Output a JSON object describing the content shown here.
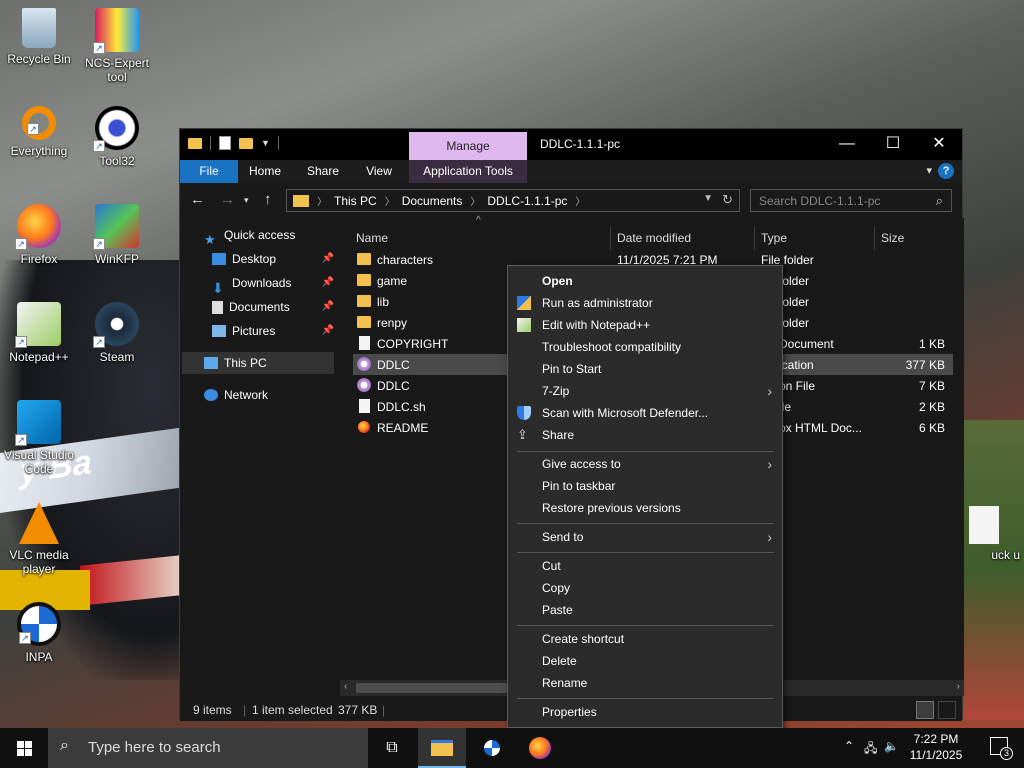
{
  "desktop": {
    "icons": [
      {
        "label": "Recycle Bin"
      },
      {
        "label": "NCS-Expert tool"
      },
      {
        "label": "Everything"
      },
      {
        "label": "Tool32"
      },
      {
        "label": "Firefox"
      },
      {
        "label": "WinKFP"
      },
      {
        "label": "Notepad++"
      },
      {
        "label": "Steam"
      },
      {
        "label": "Visual Studio Code"
      },
      {
        "label": "VLC media player"
      },
      {
        "label": "INPA"
      },
      {
        "label": "uck u"
      }
    ],
    "wallpaper_car_text": "y Ba"
  },
  "window": {
    "title": "DDLC-1.1.1-pc",
    "manage_tab": "Manage",
    "ribbon_tabs": [
      "File",
      "Home",
      "Share",
      "View",
      "Application Tools"
    ],
    "controls": {
      "minimize": "—",
      "maximize": "☐",
      "close": "✕"
    },
    "help": "?"
  },
  "address": {
    "crumbs": [
      "This PC",
      "Documents",
      "DDLC-1.1.1-pc"
    ],
    "search_placeholder": "Search DDLC-1.1.1-pc"
  },
  "nav_pane": {
    "items": [
      "Quick access",
      "Desktop",
      "Downloads",
      "Documents",
      "Pictures",
      "This PC",
      "Network"
    ]
  },
  "columns": {
    "name": "Name",
    "date": "Date modified",
    "type": "Type",
    "size": "Size"
  },
  "files": [
    {
      "name": "characters",
      "date": "11/1/2025 7:21 PM",
      "type": "File folder",
      "size": ""
    },
    {
      "name": "game",
      "date": "",
      "type": "folder",
      "size": ""
    },
    {
      "name": "lib",
      "date": "",
      "type": "folder",
      "size": ""
    },
    {
      "name": "renpy",
      "date": "",
      "type": "folder",
      "size": ""
    },
    {
      "name": "COPYRIGHT",
      "date": "",
      "type": "Document",
      "size": "1 KB"
    },
    {
      "name": "DDLC",
      "date": "",
      "type": "ication",
      "size": "377 KB"
    },
    {
      "name": "DDLC",
      "date": "",
      "type": "on File",
      "size": "7 KB"
    },
    {
      "name": "DDLC.sh",
      "date": "",
      "type": "ile",
      "size": "2 KB"
    },
    {
      "name": "README",
      "date": "",
      "type": "ox HTML Doc...",
      "size": "6 KB"
    }
  ],
  "status": {
    "items": "9 items",
    "selected": "1 item selected",
    "size": "377 KB"
  },
  "context_menu": {
    "items": [
      {
        "label": "Open"
      },
      {
        "label": "Run as administrator"
      },
      {
        "label": "Edit with Notepad++"
      },
      {
        "label": "Troubleshoot compatibility"
      },
      {
        "label": "Pin to Start"
      },
      {
        "label": "7-Zip"
      },
      {
        "label": "Scan with Microsoft Defender..."
      },
      {
        "label": "Share"
      },
      {
        "label": "Give access to"
      },
      {
        "label": "Pin to taskbar"
      },
      {
        "label": "Restore previous versions"
      },
      {
        "label": "Send to"
      },
      {
        "label": "Cut"
      },
      {
        "label": "Copy"
      },
      {
        "label": "Paste"
      },
      {
        "label": "Create shortcut"
      },
      {
        "label": "Delete"
      },
      {
        "label": "Rename"
      },
      {
        "label": "Properties"
      }
    ]
  },
  "taskbar": {
    "search_placeholder": "Type here to search",
    "time": "7:22 PM",
    "date": "11/1/2025",
    "notification_count": "3"
  },
  "colors": {
    "accent": "#1a72c2",
    "manage_tab": "#e0b8f0",
    "folder": "#f2c14e"
  }
}
